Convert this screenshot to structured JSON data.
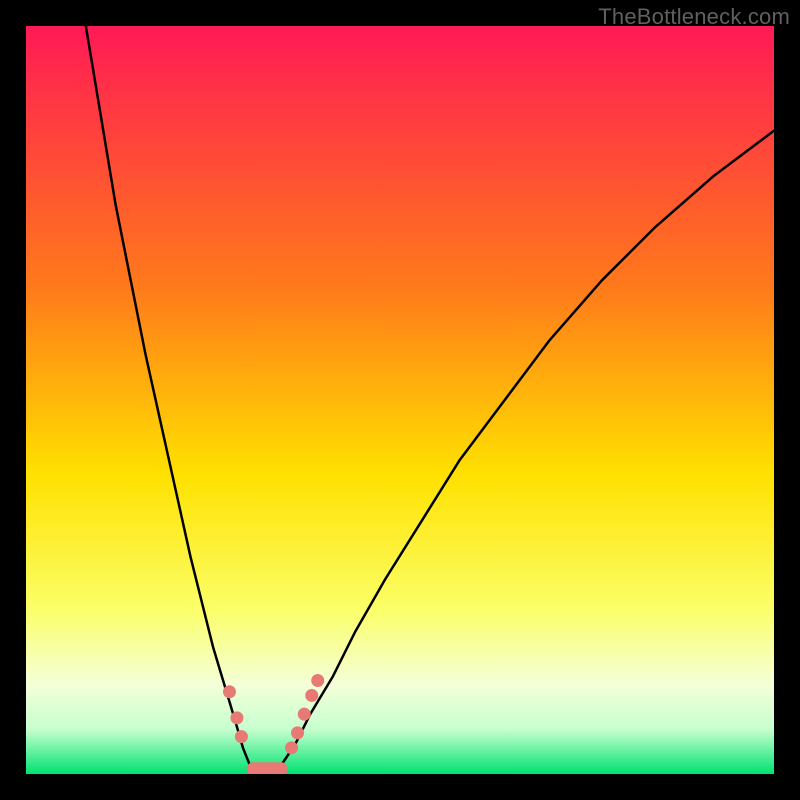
{
  "watermark": "TheBottleneck.com",
  "chart_data": {
    "type": "line",
    "title": "",
    "xlabel": "",
    "ylabel": "",
    "xlim": [
      0,
      100
    ],
    "ylim": [
      0,
      100
    ],
    "gradient_stops": [
      {
        "offset": 0.0,
        "color": "#ff1a55"
      },
      {
        "offset": 0.35,
        "color": "#ff7a1a"
      },
      {
        "offset": 0.6,
        "color": "#ffe100"
      },
      {
        "offset": 0.78,
        "color": "#fbff68"
      },
      {
        "offset": 0.88,
        "color": "#f4ffd8"
      },
      {
        "offset": 0.94,
        "color": "#c8ffcf"
      },
      {
        "offset": 1.0,
        "color": "#00e271"
      }
    ],
    "series": [
      {
        "name": "left-curve",
        "x": [
          8,
          10,
          12,
          14,
          16,
          18,
          20,
          22,
          23.5,
          25,
          26.5,
          28,
          29,
          30
        ],
        "values": [
          100,
          88,
          76,
          66,
          56,
          47,
          38,
          29,
          23,
          17,
          12,
          7,
          3.5,
          1
        ]
      },
      {
        "name": "right-curve",
        "x": [
          34,
          36,
          38,
          41,
          44,
          48,
          53,
          58,
          64,
          70,
          77,
          84,
          92,
          100
        ],
        "values": [
          1,
          4,
          8,
          13,
          19,
          26,
          34,
          42,
          50,
          58,
          66,
          73,
          80,
          86
        ]
      },
      {
        "name": "valley-floor",
        "x": [
          30,
          31,
          32,
          33,
          34
        ],
        "values": [
          1,
          0.5,
          0.3,
          0.5,
          1
        ]
      }
    ],
    "markers": {
      "left_dots": [
        {
          "x": 27.2,
          "y": 11
        },
        {
          "x": 28.2,
          "y": 7.5
        },
        {
          "x": 28.8,
          "y": 5
        }
      ],
      "right_dots": [
        {
          "x": 35.5,
          "y": 3.5
        },
        {
          "x": 36.3,
          "y": 5.5
        },
        {
          "x": 37.2,
          "y": 8
        },
        {
          "x": 38.2,
          "y": 10.5
        },
        {
          "x": 39.0,
          "y": 12.5
        }
      ],
      "bottom_bar": {
        "x0": 29.5,
        "x1": 35.0,
        "y": 0.7
      }
    },
    "marker_color": "#e77a74",
    "curve_color": "#000000"
  }
}
